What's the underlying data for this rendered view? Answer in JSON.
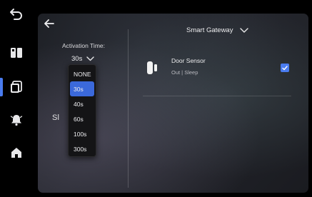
{
  "rail": {
    "items": [
      {
        "id": "back",
        "icon": "back-arrow-icon"
      },
      {
        "id": "devices",
        "icon": "device-panels-icon"
      },
      {
        "id": "scenes",
        "icon": "tablet-stack-icon",
        "active": true
      },
      {
        "id": "alarms",
        "icon": "bell-icon"
      },
      {
        "id": "home",
        "icon": "home-icon"
      }
    ]
  },
  "panel": {
    "back_icon": "left-arrow-icon",
    "activation": {
      "label": "Activation Time:",
      "value": "30s"
    },
    "dropdown": {
      "options": [
        "NONE",
        "30s",
        "40s",
        "60s",
        "100s",
        "300s"
      ],
      "selected": "30s"
    },
    "obscured_text": "Sl           de",
    "gateway": {
      "label": "Smart Gateway"
    },
    "device": {
      "name": "Door Sensor",
      "status": "Out | Sleep",
      "checked": true
    }
  },
  "colors": {
    "accent": "#4a7cf0",
    "selected_option": "#3b69db",
    "background": "#000000"
  }
}
